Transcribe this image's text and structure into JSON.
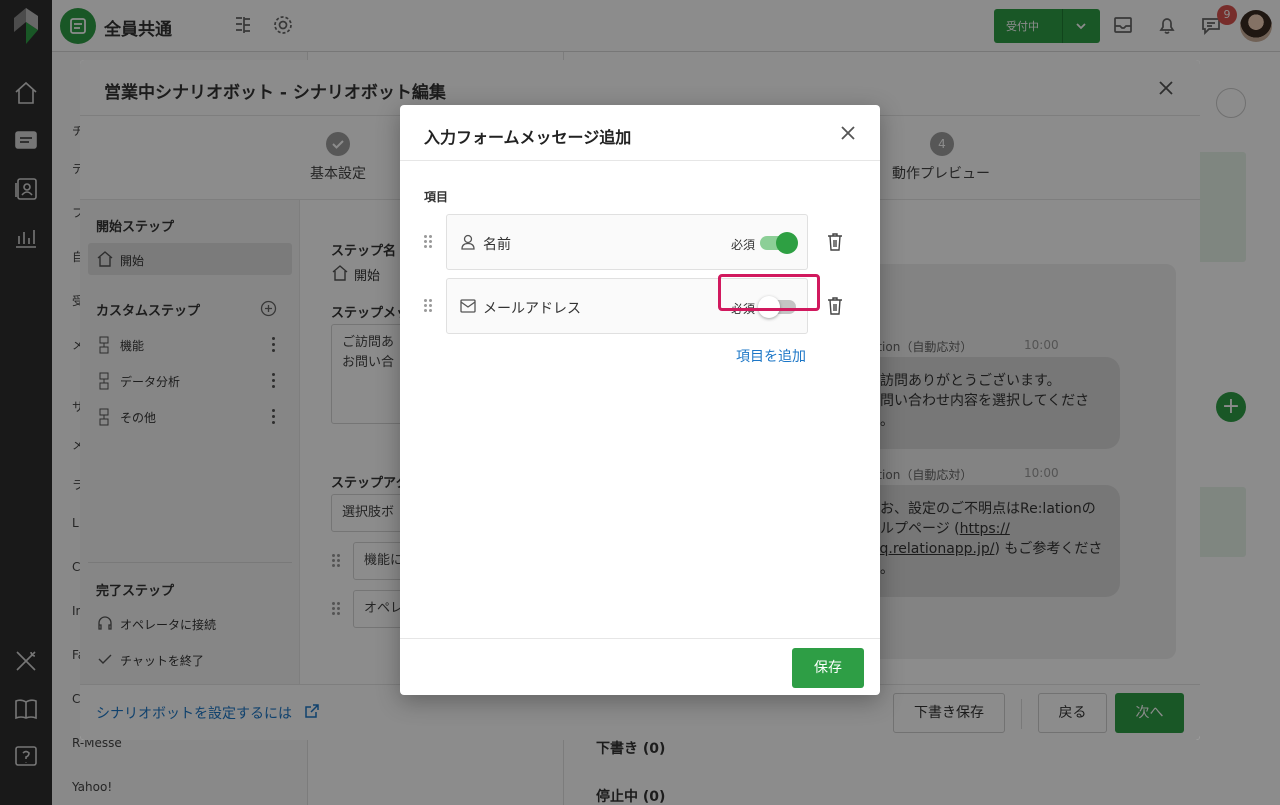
{
  "app": {
    "channel_title": "全員共通",
    "status_label": "受付中",
    "notification_count": "9"
  },
  "background": {
    "sidebar_fragments": [
      "チ",
      "テ",
      "フ",
      "自",
      "受",
      "メ",
      "サ",
      "メ",
      "ラ",
      "L",
      "C",
      "In",
      "Fa",
      "C",
      "R-Messe",
      "Yahoo!"
    ],
    "list_sections": {
      "draft": "下書き (0)",
      "stopped": "停止中 (0)"
    }
  },
  "editor": {
    "title": "営業中シナリオボット - シナリオボット編集",
    "steps": [
      {
        "label": "基本設定",
        "state": "done"
      },
      {
        "number": "4",
        "label": "動作プレビュー",
        "state": "pending"
      }
    ],
    "left": {
      "start_heading": "開始ステップ",
      "start_item": "開始",
      "custom_heading": "カスタムステップ",
      "custom_items": [
        "機能",
        "データ分析",
        "その他"
      ],
      "end_heading": "完了ステップ",
      "end_items": [
        "オペレータに接続",
        "チャットを終了"
      ]
    },
    "mid": {
      "step_name_label": "ステップ名",
      "step_name_value": "開始",
      "step_message_label": "ステップメッ",
      "message_line1": "ご訪問あ",
      "message_line2": "お問い合",
      "action_label": "ステップアク",
      "action_select": "選択肢ボ",
      "choice1": "機能に",
      "choice2": "オペレ"
    },
    "preview": {
      "msg1_name": "ation（自動応対）",
      "msg1_time": "10:00",
      "msg1_line1": "ご訪問ありがとうございます。",
      "msg1_line2": "お問い合わせ内容を選択してくださ",
      "msg1_line3": "い。",
      "msg2_name": "ation（自動応対）",
      "msg2_time": "10:00",
      "msg2_line1": "なお、設定のご不明点はRe:lationの",
      "msg2_line2a": "ヘルプページ (",
      "msg2_line2b": "https://",
      "msg2_line3a": "faq.relationapp.jp/",
      "msg2_line3b": ") もご参考くださ",
      "msg2_line4": "い。"
    },
    "footer": {
      "help_link": "シナリオボットを設定するには",
      "draft_save": "下書き保存",
      "back": "戻る",
      "next": "次へ"
    }
  },
  "dialog": {
    "title": "入力フォームメッセージ追加",
    "section_label": "項目",
    "items": [
      {
        "icon": "person-icon",
        "label": "名前",
        "required_label": "必須",
        "required": true
      },
      {
        "icon": "mail-icon",
        "label": "メールアドレス",
        "required_label": "必須",
        "required": false
      }
    ],
    "add_item": "項目を追加",
    "save": "保存"
  },
  "colors": {
    "accent": "#2e9e45",
    "link": "#1d77c7",
    "highlight": "#d1195e"
  }
}
